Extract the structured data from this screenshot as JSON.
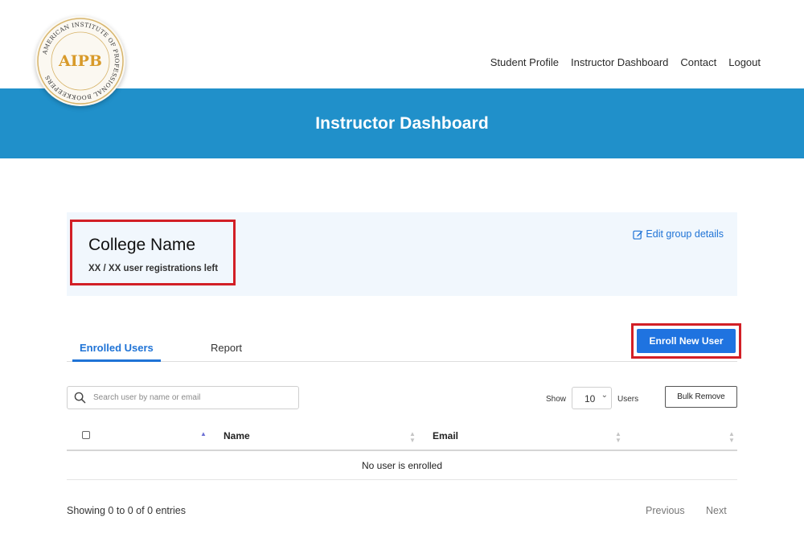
{
  "logo": {
    "text": "AIPB",
    "ring_text": "AMERICAN INSTITUTE OF PROFESSIONAL BOOKKEEPERS",
    "color": "#d89a2a"
  },
  "nav": {
    "items": [
      "Student Profile",
      "Instructor Dashboard",
      "Contact",
      "Logout"
    ]
  },
  "banner": {
    "title": "Instructor Dashboard",
    "color": "#2090ca"
  },
  "group": {
    "name": "College Name",
    "registrations": "XX / XX user registrations left",
    "edit_label": "Edit group details",
    "highlight_color": "#d21f26"
  },
  "tabs": {
    "enrolled_label": "Enrolled Users",
    "report_label": "Report"
  },
  "enroll": {
    "label": "Enroll New User",
    "color": "#1f73e0"
  },
  "search": {
    "placeholder": "Search user by name or email",
    "icon": "search-icon"
  },
  "page_size": {
    "show_label": "Show",
    "value": "10",
    "users_label": "Users"
  },
  "bulk_remove": {
    "label": "Bulk Remove"
  },
  "table": {
    "columns": [
      "",
      "Name",
      "Email",
      ""
    ],
    "empty_message": "No user is enrolled"
  },
  "footer": {
    "showing": "Showing 0 to 0 of 0 entries",
    "previous_label": "Previous",
    "next_label": "Next"
  }
}
